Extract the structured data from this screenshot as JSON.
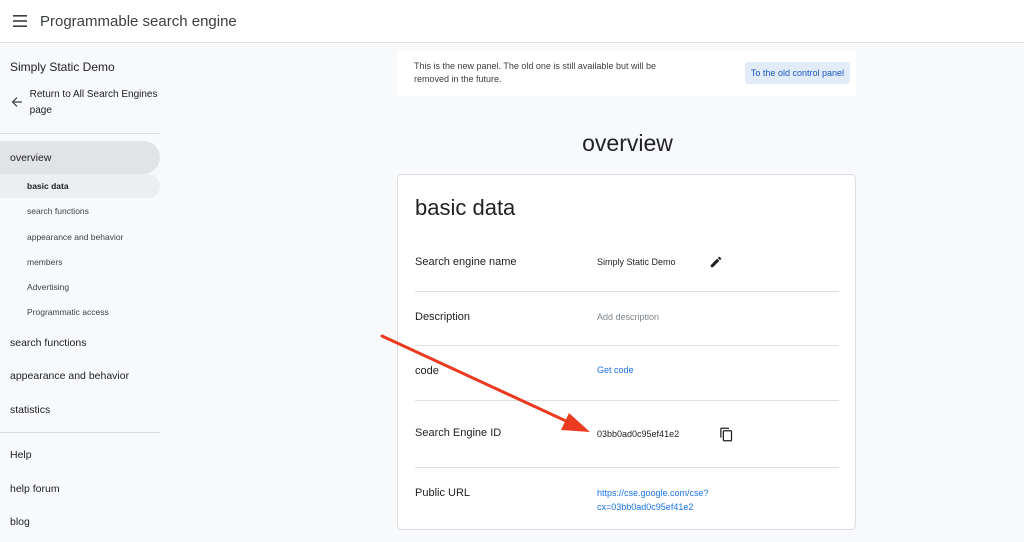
{
  "header": {
    "title": "Programmable search engine"
  },
  "sidebar": {
    "project_name": "Simply Static Demo",
    "back_link": "Return to All Search Engines page",
    "nav": [
      {
        "label": "overview",
        "active": true
      },
      {
        "label": "search functions"
      },
      {
        "label": "appearance and behavior"
      },
      {
        "label": "statistics"
      }
    ],
    "sub_items": [
      {
        "label": "basic data",
        "active": true
      },
      {
        "label": "search functions"
      },
      {
        "label": "appearance and behavior"
      },
      {
        "label": "members"
      },
      {
        "label": "Advertising"
      },
      {
        "label": "Programmatic access"
      }
    ],
    "footer_items": [
      {
        "label": "Help"
      },
      {
        "label": "help forum"
      },
      {
        "label": "blog"
      }
    ]
  },
  "banner": {
    "message": "This is the new panel. The old one is still available but will be removed in the future.",
    "button_label": "To the old control panel"
  },
  "main": {
    "heading": "overview",
    "card": {
      "title": "basic data",
      "rows": [
        {
          "label": "Search engine name",
          "value": "Simply Static Demo"
        },
        {
          "label": "Description",
          "value": "Add description"
        },
        {
          "label": "code",
          "value": "Get code"
        },
        {
          "label": "Search Engine ID",
          "value": "03bb0ad0c95ef41e2"
        },
        {
          "label": "Public URL",
          "value_line1": "https://cse.google.com/cse?",
          "value_line2": "cx=03bb0ad0c95ef41e2"
        }
      ]
    }
  },
  "icons": {
    "menu": "menu-icon",
    "back": "arrow-left-icon",
    "edit": "pencil-icon",
    "copy": "copy-icon"
  },
  "colors": {
    "link": "#1a73e8",
    "annotation_arrow": "#ea3a1f",
    "active_nav": "#e2e3e5"
  }
}
